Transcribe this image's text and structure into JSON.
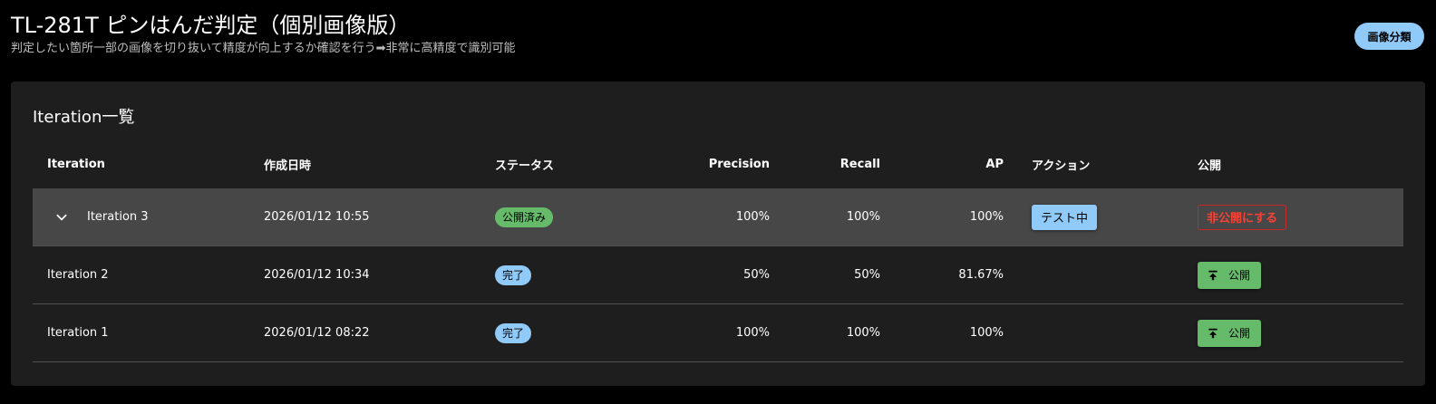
{
  "header": {
    "title": "TL-281T ピンはんだ判定（個別画像版）",
    "subtitle": "判定したい箇所一部の画像を切り抜いて精度が向上するか確認を行う➡非常に高精度で識別可能",
    "classify_button": "画像分類"
  },
  "card": {
    "title": "Iteration一覧"
  },
  "columns": {
    "iteration": "Iteration",
    "created": "作成日時",
    "status": "ステータス",
    "precision": "Precision",
    "recall": "Recall",
    "ap": "AP",
    "action": "アクション",
    "public": "公開"
  },
  "rows": [
    {
      "iteration": "Iteration 3",
      "created": "2026/01/12 10:55",
      "status": "公開済み",
      "precision": "100%",
      "recall": "100%",
      "ap": "100%",
      "action": "テスト中",
      "public": "非公開にする"
    },
    {
      "iteration": "Iteration 2",
      "created": "2026/01/12 10:34",
      "status": "完了",
      "precision": "50%",
      "recall": "50%",
      "ap": "81.67%",
      "action": "",
      "public": "公開"
    },
    {
      "iteration": "Iteration 1",
      "created": "2026/01/12 08:22",
      "status": "完了",
      "precision": "100%",
      "recall": "100%",
      "ap": "100%",
      "action": "",
      "public": "公開"
    }
  ],
  "icons": {
    "expand": "chevron-down-icon",
    "publish": "publish-upload-icon"
  },
  "colors": {
    "published_chip": "#66bb6a",
    "done_chip": "#90caf9",
    "unpublish_red": "#f44336",
    "publish_green": "#66bb6a"
  }
}
